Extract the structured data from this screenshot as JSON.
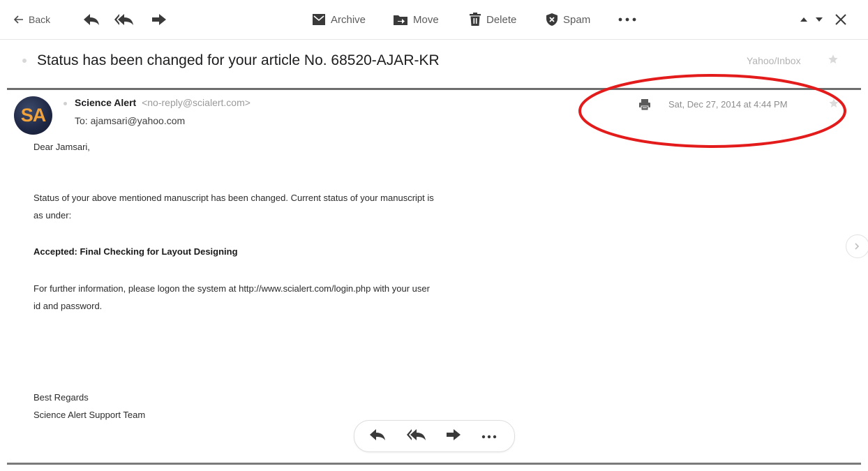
{
  "toolbar": {
    "back_label": "Back",
    "archive_label": "Archive",
    "move_label": "Move",
    "delete_label": "Delete",
    "spam_label": "Spam"
  },
  "message": {
    "subject": "Status has been changed for your article No. 68520-AJAR-KR",
    "folder": "Yahoo/Inbox",
    "sender_name": "Science Alert",
    "sender_email": "<no-reply@scialert.com>",
    "to": "To: ajamsari@yahoo.com",
    "date": "Sat, Dec 27, 2014 at 4:44 PM",
    "avatar_initials": "SA"
  },
  "body": {
    "greeting": "Dear Jamsari,",
    "para1_line1": "Status of your above mentioned manuscript has been changed. Current status of your manuscript is",
    "para1_line2": "as under:",
    "status": "Accepted: Final Checking for Layout Designing",
    "para2_line1": "For further information, please logon the system at http://www.scialert.com/login.php with your user",
    "para2_line2": "id and password.",
    "closing1": "Best Regards",
    "closing2": "Science Alert Support Team"
  },
  "colors": {
    "annotation": "#e31b1b",
    "icon": "#3a3a3a",
    "avatar_text": "#f2a23b",
    "avatar_bg": "#1e2744"
  },
  "icons": {
    "back": "arrow-left-icon",
    "reply": "reply-icon",
    "reply_all": "reply-all-icon",
    "forward": "forward-icon",
    "archive": "archive-icon",
    "move": "move-folder-icon",
    "delete": "trash-icon",
    "spam": "shield-icon",
    "more": "more-dots-icon",
    "previous": "caret-up-icon",
    "next": "caret-down-icon",
    "close": "close-icon",
    "print": "print-icon",
    "star": "star-icon",
    "side": "chevron-right-icon"
  }
}
